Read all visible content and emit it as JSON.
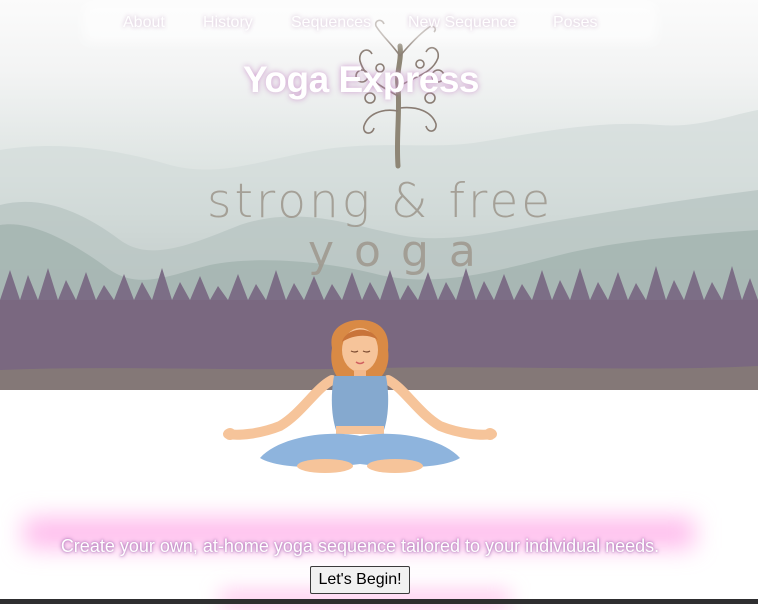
{
  "nav": {
    "items": [
      {
        "label": "About"
      },
      {
        "label": "History"
      },
      {
        "label": "Sequences"
      },
      {
        "label": "New Sequence"
      },
      {
        "label": "Poses"
      }
    ]
  },
  "hero": {
    "title": "Yoga Express",
    "logo_line1": "strong & free",
    "logo_line2": "yoga"
  },
  "main": {
    "tagline": "Create your own, at-home yoga sequence tailored to your individual needs.",
    "begin_button": "Let's Begin!"
  },
  "colors": {
    "title_glow": "#ff6ed2",
    "logo_text": "#a09a90",
    "mountain_haze": "#dce3e1",
    "forest": "#7b6a82"
  }
}
